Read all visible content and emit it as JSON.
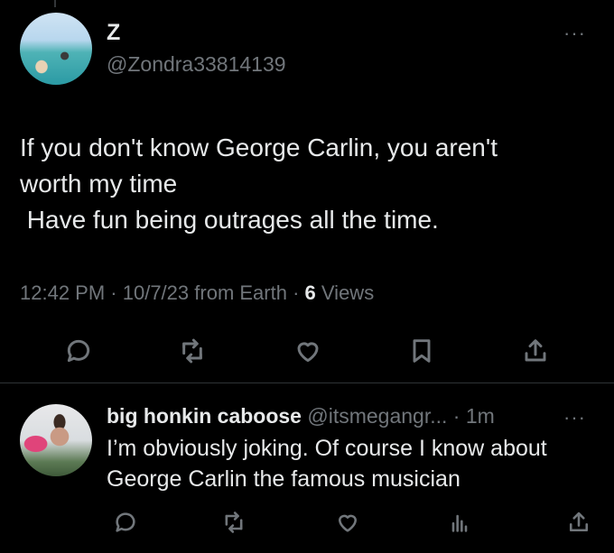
{
  "main_tweet": {
    "author_name": "Z",
    "author_handle": "@Zondra33814139",
    "more_label": "···",
    "text": "If you don't know George Carlin, you aren't\nworth my time\n Have fun being outrages all the time.",
    "time": "12:42 PM",
    "date": "10/7/23",
    "source": "from Earth",
    "view_count": "6",
    "views_label": "Views",
    "separator": " · ",
    "icons": [
      "reply-icon",
      "retweet-icon",
      "like-icon",
      "bookmark-icon",
      "share-icon"
    ]
  },
  "reply": {
    "author_name": "big honkin caboose",
    "author_handle": "@itsmegangr...",
    "time_ago": "1m",
    "separator": " · ",
    "more_label": "···",
    "text": "I’m obviously joking. Of course I know about George Carlin the famous musician",
    "icons": [
      "reply-icon",
      "retweet-icon",
      "like-icon",
      "views-icon",
      "share-icon"
    ]
  },
  "colors": {
    "background": "#000000",
    "text_primary": "#e7e9ea",
    "text_secondary": "#71767b",
    "divider": "#2f3336"
  }
}
